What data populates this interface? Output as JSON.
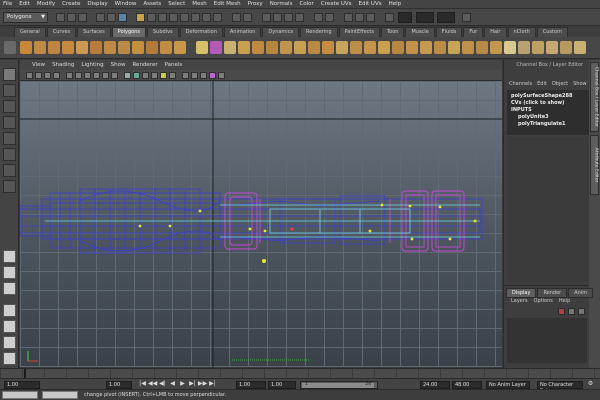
{
  "menubar": {
    "items": [
      "File",
      "Edit",
      "Modify",
      "Create",
      "Display",
      "Window",
      "Assets",
      "Select",
      "Mesh",
      "Edit Mesh",
      "Proxy",
      "Normals",
      "Color",
      "Create UVs",
      "Edit UVs",
      "Help"
    ]
  },
  "statusline": {
    "mode": "Polygons"
  },
  "shelf": {
    "tabs": [
      "General",
      "Curves",
      "Surfaces",
      "Polygons",
      "Subdivs",
      "Deformation",
      "Animation",
      "Dynamics",
      "Rendering",
      "PaintEffects",
      "Toon",
      "Muscle",
      "Fluids",
      "Fur",
      "Hair",
      "nCloth",
      "Custom"
    ],
    "active_tab": "Polygons"
  },
  "panel": {
    "menu": [
      "View",
      "Shading",
      "Lighting",
      "Show",
      "Renderer",
      "Panels"
    ]
  },
  "channel_box": {
    "title": "Channel Box / Layer Editor",
    "menu": [
      "Channels",
      "Edit",
      "Object",
      "Show"
    ],
    "lines": [
      "polySurfaceShape288",
      "CVs (click to show)",
      "INPUTS",
      "polyUnite3",
      "polyTriangulate1"
    ]
  },
  "side_tabs": {
    "channel": "Channel Box / Layer Editor",
    "attribute": "Attribute Editor"
  },
  "layer_editor": {
    "tabs": [
      "Display",
      "Render",
      "Anim"
    ],
    "active_tab": "Display",
    "menu": [
      "Layers",
      "Options",
      "Help"
    ]
  },
  "range": {
    "start": "1.00",
    "current_start": "1.00",
    "playback_start": "1.00",
    "current_frame": "1.00",
    "frame_marker": "1",
    "frame_end_marker": "24",
    "playback_end": "24.00",
    "end": "48.00",
    "anim_layer": "No Anim Layer",
    "character_set": "No Character Set"
  },
  "transport": [
    "|◀",
    "◀◀",
    "◀|",
    "◀",
    "▶",
    "▶|",
    "▶▶",
    "▶|"
  ],
  "helpline": {
    "text": "change pivot (INSERT).  Ctrl+LMB to move perpendicular."
  },
  "colors": {
    "viewport_bg": "#4d5660",
    "wire_blue": "#3a3fd0",
    "wire_cyan": "#6fd6e6",
    "wire_magenta": "#c84ad8",
    "vertex_yellow": "#e8e830"
  }
}
